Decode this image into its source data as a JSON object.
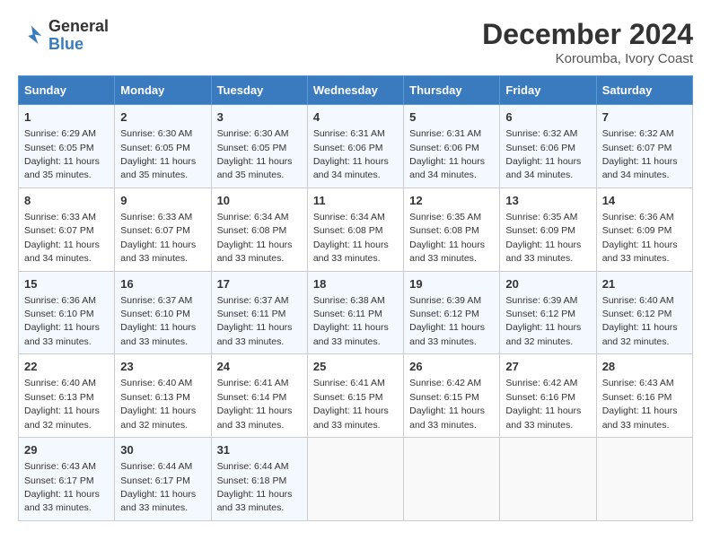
{
  "logo": {
    "line1": "General",
    "line2": "Blue"
  },
  "title": "December 2024",
  "subtitle": "Koroumba, Ivory Coast",
  "days_header": [
    "Sunday",
    "Monday",
    "Tuesday",
    "Wednesday",
    "Thursday",
    "Friday",
    "Saturday"
  ],
  "weeks": [
    [
      {
        "day": "1",
        "sunrise": "6:29 AM",
        "sunset": "6:05 PM",
        "daylight": "11 hours and 35 minutes."
      },
      {
        "day": "2",
        "sunrise": "6:30 AM",
        "sunset": "6:05 PM",
        "daylight": "11 hours and 35 minutes."
      },
      {
        "day": "3",
        "sunrise": "6:30 AM",
        "sunset": "6:05 PM",
        "daylight": "11 hours and 35 minutes."
      },
      {
        "day": "4",
        "sunrise": "6:31 AM",
        "sunset": "6:06 PM",
        "daylight": "11 hours and 34 minutes."
      },
      {
        "day": "5",
        "sunrise": "6:31 AM",
        "sunset": "6:06 PM",
        "daylight": "11 hours and 34 minutes."
      },
      {
        "day": "6",
        "sunrise": "6:32 AM",
        "sunset": "6:06 PM",
        "daylight": "11 hours and 34 minutes."
      },
      {
        "day": "7",
        "sunrise": "6:32 AM",
        "sunset": "6:07 PM",
        "daylight": "11 hours and 34 minutes."
      }
    ],
    [
      {
        "day": "8",
        "sunrise": "6:33 AM",
        "sunset": "6:07 PM",
        "daylight": "11 hours and 34 minutes."
      },
      {
        "day": "9",
        "sunrise": "6:33 AM",
        "sunset": "6:07 PM",
        "daylight": "11 hours and 33 minutes."
      },
      {
        "day": "10",
        "sunrise": "6:34 AM",
        "sunset": "6:08 PM",
        "daylight": "11 hours and 33 minutes."
      },
      {
        "day": "11",
        "sunrise": "6:34 AM",
        "sunset": "6:08 PM",
        "daylight": "11 hours and 33 minutes."
      },
      {
        "day": "12",
        "sunrise": "6:35 AM",
        "sunset": "6:08 PM",
        "daylight": "11 hours and 33 minutes."
      },
      {
        "day": "13",
        "sunrise": "6:35 AM",
        "sunset": "6:09 PM",
        "daylight": "11 hours and 33 minutes."
      },
      {
        "day": "14",
        "sunrise": "6:36 AM",
        "sunset": "6:09 PM",
        "daylight": "11 hours and 33 minutes."
      }
    ],
    [
      {
        "day": "15",
        "sunrise": "6:36 AM",
        "sunset": "6:10 PM",
        "daylight": "11 hours and 33 minutes."
      },
      {
        "day": "16",
        "sunrise": "6:37 AM",
        "sunset": "6:10 PM",
        "daylight": "11 hours and 33 minutes."
      },
      {
        "day": "17",
        "sunrise": "6:37 AM",
        "sunset": "6:11 PM",
        "daylight": "11 hours and 33 minutes."
      },
      {
        "day": "18",
        "sunrise": "6:38 AM",
        "sunset": "6:11 PM",
        "daylight": "11 hours and 33 minutes."
      },
      {
        "day": "19",
        "sunrise": "6:39 AM",
        "sunset": "6:12 PM",
        "daylight": "11 hours and 33 minutes."
      },
      {
        "day": "20",
        "sunrise": "6:39 AM",
        "sunset": "6:12 PM",
        "daylight": "11 hours and 32 minutes."
      },
      {
        "day": "21",
        "sunrise": "6:40 AM",
        "sunset": "6:12 PM",
        "daylight": "11 hours and 32 minutes."
      }
    ],
    [
      {
        "day": "22",
        "sunrise": "6:40 AM",
        "sunset": "6:13 PM",
        "daylight": "11 hours and 32 minutes."
      },
      {
        "day": "23",
        "sunrise": "6:40 AM",
        "sunset": "6:13 PM",
        "daylight": "11 hours and 32 minutes."
      },
      {
        "day": "24",
        "sunrise": "6:41 AM",
        "sunset": "6:14 PM",
        "daylight": "11 hours and 33 minutes."
      },
      {
        "day": "25",
        "sunrise": "6:41 AM",
        "sunset": "6:15 PM",
        "daylight": "11 hours and 33 minutes."
      },
      {
        "day": "26",
        "sunrise": "6:42 AM",
        "sunset": "6:15 PM",
        "daylight": "11 hours and 33 minutes."
      },
      {
        "day": "27",
        "sunrise": "6:42 AM",
        "sunset": "6:16 PM",
        "daylight": "11 hours and 33 minutes."
      },
      {
        "day": "28",
        "sunrise": "6:43 AM",
        "sunset": "6:16 PM",
        "daylight": "11 hours and 33 minutes."
      }
    ],
    [
      {
        "day": "29",
        "sunrise": "6:43 AM",
        "sunset": "6:17 PM",
        "daylight": "11 hours and 33 minutes."
      },
      {
        "day": "30",
        "sunrise": "6:44 AM",
        "sunset": "6:17 PM",
        "daylight": "11 hours and 33 minutes."
      },
      {
        "day": "31",
        "sunrise": "6:44 AM",
        "sunset": "6:18 PM",
        "daylight": "11 hours and 33 minutes."
      },
      null,
      null,
      null,
      null
    ]
  ]
}
